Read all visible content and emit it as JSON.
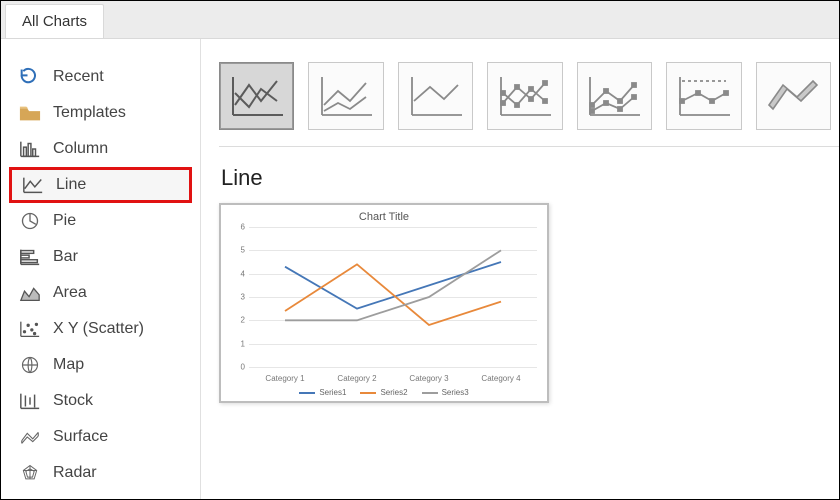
{
  "tab": {
    "label": "All Charts"
  },
  "sidebar": {
    "items": [
      {
        "label": "Recent"
      },
      {
        "label": "Templates"
      },
      {
        "label": "Column"
      },
      {
        "label": "Line"
      },
      {
        "label": "Pie"
      },
      {
        "label": "Bar"
      },
      {
        "label": "Area"
      },
      {
        "label": "X Y (Scatter)"
      },
      {
        "label": "Map"
      },
      {
        "label": "Stock"
      },
      {
        "label": "Surface"
      },
      {
        "label": "Radar"
      }
    ]
  },
  "main": {
    "selected_subtype_title": "Line"
  },
  "chart_data": {
    "type": "line",
    "title": "Chart Title",
    "categories": [
      "Category 1",
      "Category 2",
      "Category 3",
      "Category 4"
    ],
    "series": [
      {
        "name": "Series1",
        "values": [
          4.3,
          2.5,
          3.5,
          4.5
        ],
        "color": "#4577b7"
      },
      {
        "name": "Series2",
        "values": [
          2.4,
          4.4,
          1.8,
          2.8
        ],
        "color": "#e8893b"
      },
      {
        "name": "Series3",
        "values": [
          2.0,
          2.0,
          3.0,
          5.0
        ],
        "color": "#9d9d9d"
      }
    ],
    "ylim": [
      0,
      6
    ],
    "yticks": [
      0,
      1,
      2,
      3,
      4,
      5,
      6
    ],
    "xlabel": "",
    "ylabel": ""
  }
}
